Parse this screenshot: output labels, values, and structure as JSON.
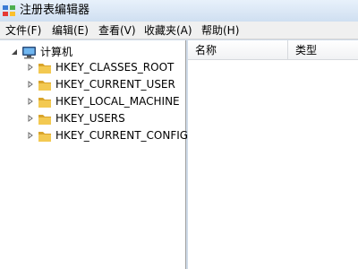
{
  "window": {
    "title": "注册表编辑器"
  },
  "menu": [
    {
      "label": "文件(F)"
    },
    {
      "label": "编辑(E)"
    },
    {
      "label": "查看(V)"
    },
    {
      "label": "收藏夹(A)"
    },
    {
      "label": "帮助(H)"
    }
  ],
  "tree": {
    "root": {
      "label": "计算机",
      "icon": "computer-icon",
      "expanded": true
    },
    "children": [
      {
        "label": "HKEY_CLASSES_ROOT",
        "icon": "folder-icon"
      },
      {
        "label": "HKEY_CURRENT_USER",
        "icon": "folder-icon"
      },
      {
        "label": "HKEY_LOCAL_MACHINE",
        "icon": "folder-icon"
      },
      {
        "label": "HKEY_USERS",
        "icon": "folder-icon"
      },
      {
        "label": "HKEY_CURRENT_CONFIG",
        "icon": "folder-icon"
      }
    ]
  },
  "list": {
    "columns": [
      {
        "label": "名称"
      },
      {
        "label": "类型"
      }
    ]
  },
  "colors": {
    "folder": "#f3c951",
    "folder_dark": "#d9a42a",
    "title_bg": "#d7e4f2"
  }
}
